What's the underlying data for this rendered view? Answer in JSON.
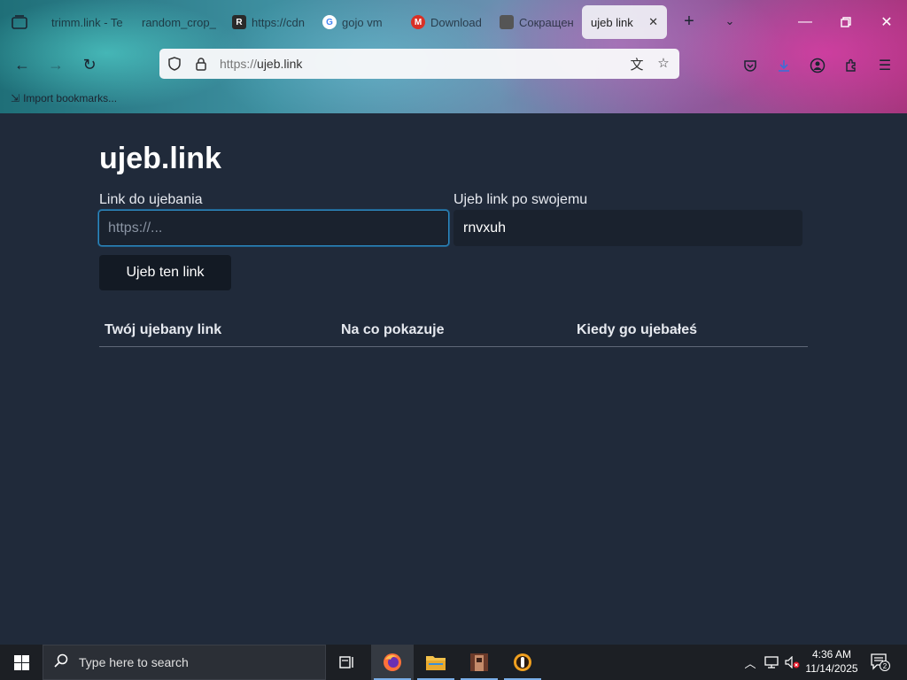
{
  "tabs": [
    {
      "label": "trimm.link - Te",
      "fav_color": "#3b4b5c",
      "fav_glyph": ""
    },
    {
      "label": "random_crop_",
      "fav_color": "#3b4b5c",
      "fav_glyph": ""
    },
    {
      "label": "https://cdn",
      "fav_color": "#2a2a2a",
      "fav_glyph": "R"
    },
    {
      "label": "gojo vm",
      "fav_color": "#ffffff",
      "fav_glyph": "G"
    },
    {
      "label": "Download",
      "fav_color": "#d93025",
      "fav_glyph": "M"
    },
    {
      "label": "Сокращен",
      "fav_color": "#555555",
      "fav_glyph": ""
    },
    {
      "label": "ujeb link",
      "active": true
    }
  ],
  "browser": {
    "url_protocol": "https://",
    "url_host": "ujeb.link",
    "bookmarks_label": "Import bookmarks..."
  },
  "page": {
    "title": "ujeb.link",
    "link_label": "Link do ujebania",
    "link_placeholder": "https://...",
    "custom_label": "Ujeb link po swojemu",
    "custom_value": "rnvxuh",
    "submit_label": "Ujeb ten link",
    "table_headers": [
      "Twój ujebany link",
      "Na co pokazuje",
      "Kiedy go ujebałeś"
    ]
  },
  "taskbar": {
    "search_placeholder": "Type here to search",
    "time": "4:36 AM",
    "date": "11/14/2025",
    "notification_count": "2"
  },
  "colors": {
    "page_bg": "#202a3a",
    "input_bg": "#1a222e",
    "focus_border": "#2d89c0",
    "button_bg": "#131a24"
  }
}
